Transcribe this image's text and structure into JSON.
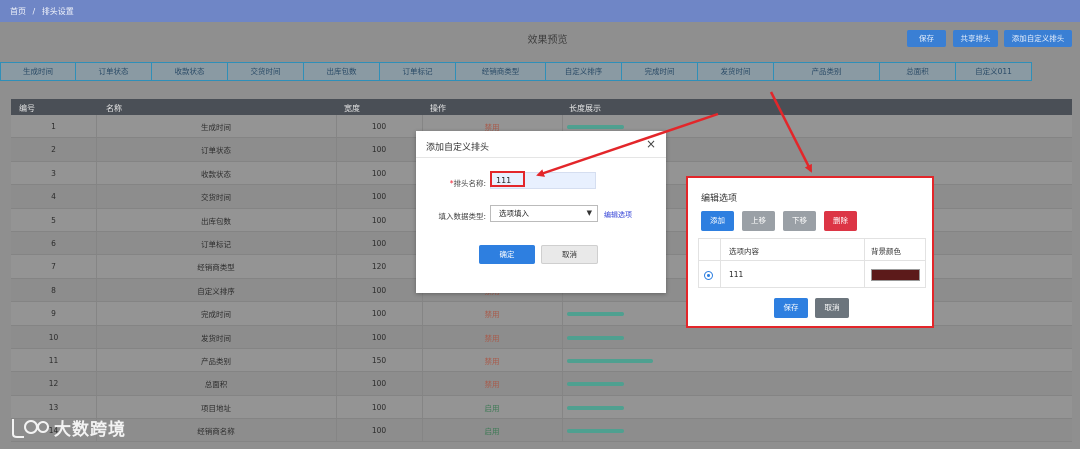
{
  "breadcrumb": [
    "首页",
    "/",
    "排头设置"
  ],
  "preview_title": "效果预览",
  "toolbar": {
    "save": "保存",
    "share": "共享排头",
    "add_custom": "添加自定义排头"
  },
  "preview_columns": [
    "生成时间",
    "订单状态",
    "收款状态",
    "交货时间",
    "出库包数",
    "订单标记",
    "经销商类型",
    "自定义排序",
    "完成时间",
    "发货时间",
    "产品类别",
    "总面积",
    "自定义011"
  ],
  "table": {
    "headers": {
      "id": "编号",
      "name": "名称",
      "width": "宽度",
      "op": "操作",
      "len": "长度展示"
    },
    "rows": [
      {
        "id": "1",
        "name": "生成时间",
        "width": "100",
        "op": "禁用",
        "status": "disabled"
      },
      {
        "id": "2",
        "name": "订单状态",
        "width": "100",
        "op": "",
        "status": "disabled"
      },
      {
        "id": "3",
        "name": "收款状态",
        "width": "100",
        "op": "",
        "status": "disabled"
      },
      {
        "id": "4",
        "name": "交货时间",
        "width": "100",
        "op": "",
        "status": "disabled"
      },
      {
        "id": "5",
        "name": "出库包数",
        "width": "100",
        "op": "",
        "status": "disabled"
      },
      {
        "id": "6",
        "name": "订单标记",
        "width": "100",
        "op": "",
        "status": "disabled"
      },
      {
        "id": "7",
        "name": "经销商类型",
        "width": "120",
        "op": "",
        "status": "disabled"
      },
      {
        "id": "8",
        "name": "自定义排序",
        "width": "100",
        "op": "禁用",
        "status": "disabled"
      },
      {
        "id": "9",
        "name": "完成时间",
        "width": "100",
        "op": "禁用",
        "status": "disabled"
      },
      {
        "id": "10",
        "name": "发货时间",
        "width": "100",
        "op": "禁用",
        "status": "disabled"
      },
      {
        "id": "11",
        "name": "产品类别",
        "width": "150",
        "op": "禁用",
        "status": "disabled"
      },
      {
        "id": "12",
        "name": "总面积",
        "width": "100",
        "op": "禁用",
        "status": "disabled"
      },
      {
        "id": "13",
        "name": "项目地址",
        "width": "100",
        "op": "启用",
        "status": "enabled"
      },
      {
        "id": "14",
        "name": "经销商名称",
        "width": "100",
        "op": "启用",
        "status": "enabled"
      }
    ]
  },
  "modal": {
    "title": "添加自定义排头",
    "close": "×",
    "name_label": "排头名称:",
    "name_required": "*",
    "name_value": "111",
    "type_label": "填入数据类型:",
    "type_value": "选项填入",
    "edit_link": "编辑选项",
    "ok": "确定",
    "cancel": "取消"
  },
  "options_panel": {
    "title": "编辑选项",
    "add": "添加",
    "up": "上移",
    "down": "下移",
    "delete": "删除",
    "col_content": "选项内容",
    "col_color": "背景颜色",
    "option_value": "111",
    "option_color": "#5c1a1a",
    "save": "保存",
    "cancel": "取消"
  },
  "watermark": "大数跨境",
  "colors": {
    "annotation_red": "#e3262a",
    "primary_blue": "#2e7fe0",
    "bar_green": "#4fa090"
  }
}
